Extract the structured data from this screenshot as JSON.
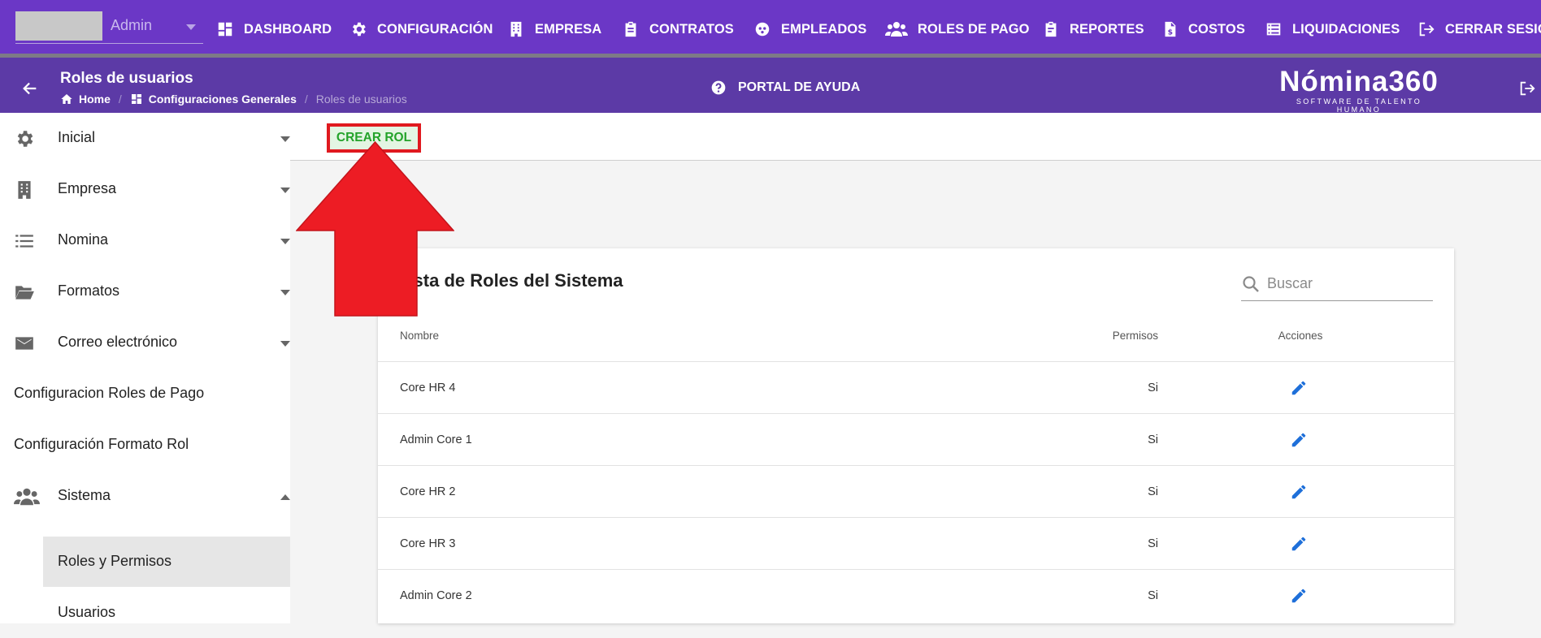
{
  "topbar": {
    "user_name": "Admin",
    "nav": [
      {
        "label": "DASHBOARD",
        "icon": "dashboard-icon"
      },
      {
        "label": "CONFIGURACIÓN",
        "icon": "gear-icon"
      },
      {
        "label": "EMPRESA",
        "icon": "building-icon"
      },
      {
        "label": "CONTRATOS",
        "icon": "clipboard-icon"
      },
      {
        "label": "EMPLEADOS",
        "icon": "employees-icon"
      },
      {
        "label": "ROLES DE PAGO",
        "icon": "users-icon"
      },
      {
        "label": "REPORTES",
        "icon": "report-icon"
      },
      {
        "label": "COSTOS",
        "icon": "invoice-icon"
      },
      {
        "label": "LIQUIDACIONES",
        "icon": "list-icon"
      },
      {
        "label": "CERRAR SESIÓN",
        "icon": "logout-icon"
      }
    ]
  },
  "header": {
    "title": "Roles de usuarios",
    "breadcrumb": [
      "Home",
      "Configuraciones Generales",
      "Roles de usuarios"
    ],
    "help_label": "PORTAL DE AYUDA",
    "logo_text": "Nómina360",
    "logo_tagline": "SOFTWARE DE TALENTO HUMANO"
  },
  "sidebar": {
    "items": [
      {
        "label": "Inicial",
        "icon": "gear-icon"
      },
      {
        "label": "Empresa",
        "icon": "building-icon"
      },
      {
        "label": "Nomina",
        "icon": "list-icon"
      },
      {
        "label": "Formatos",
        "icon": "folder-icon"
      },
      {
        "label": "Correo electrónico",
        "icon": "mail-icon"
      },
      {
        "label": "Configuracion Roles de Pago"
      },
      {
        "label": "Configuración Formato Rol"
      },
      {
        "label": "Sistema",
        "icon": "users-icon"
      }
    ],
    "sub_items": [
      {
        "label": "Roles y Permisos",
        "active": true
      },
      {
        "label": "Usuarios"
      }
    ]
  },
  "toolbar": {
    "create_label": "CREAR ROL"
  },
  "card": {
    "title": "Lista de Roles del Sistema",
    "search_placeholder": "Buscar",
    "columns": [
      "Nombre",
      "Permisos",
      "Acciones"
    ],
    "rows": [
      {
        "nombre": "Core HR 4",
        "permisos": "Si"
      },
      {
        "nombre": "Admin Core 1",
        "permisos": "Si"
      },
      {
        "nombre": "Core HR 2",
        "permisos": "Si"
      },
      {
        "nombre": "Core HR 3",
        "permisos": "Si"
      },
      {
        "nombre": "Admin Core 2",
        "permisos": "Si"
      }
    ]
  },
  "colors": {
    "topbar": "#6b37c6",
    "header": "#5c3aa6",
    "accent_green": "#23a32a",
    "highlight_red": "#e0191f",
    "edit_blue": "#1e6fd9"
  }
}
